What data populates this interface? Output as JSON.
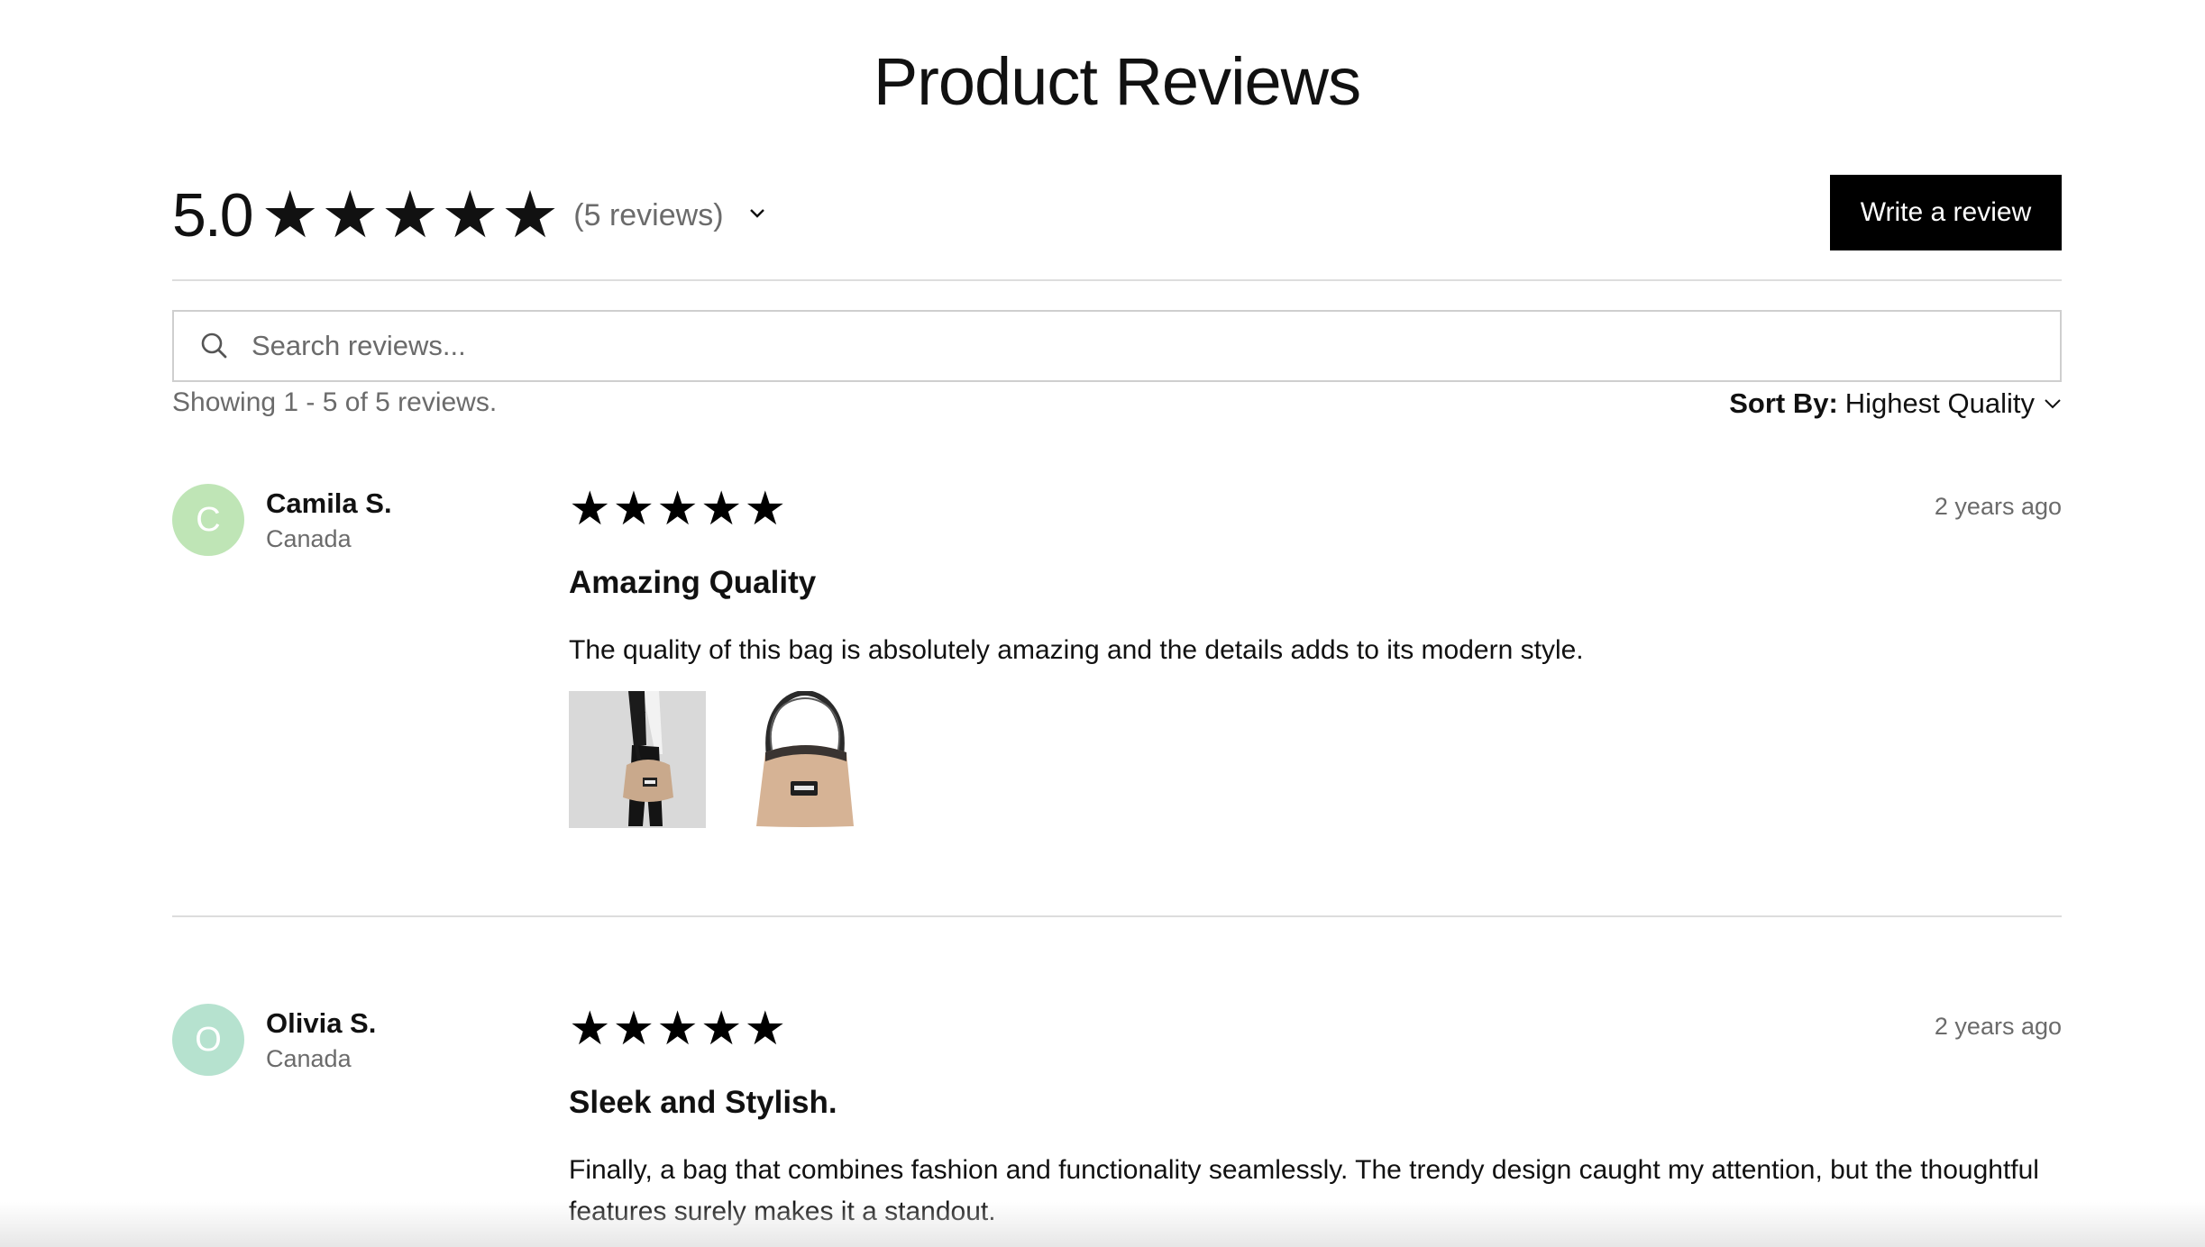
{
  "page_title": "Product Reviews",
  "summary": {
    "average": "5.0",
    "stars": "★★★★★",
    "rating_value": 5,
    "rating_max": 5,
    "count_label": "(5 reviews)"
  },
  "write_review_label": "Write a review",
  "search": {
    "placeholder": "Search reviews...",
    "value": ""
  },
  "showing_text": "Showing 1 - 5 of 5 reviews.",
  "sort": {
    "label": "Sort By:",
    "value": "Highest Quality"
  },
  "colors": {
    "button_bg": "#000000",
    "avatar_camila": "#bfe5b6",
    "avatar_olivia": "#b6e2cf",
    "muted_text": "#6b6b6b"
  },
  "reviews": [
    {
      "initial": "C",
      "name": "Camila S.",
      "location": "Canada",
      "stars": "★★★★★",
      "rating": 5,
      "date": "2 years ago",
      "title": "Amazing Quality",
      "body": "The quality of this bag is absolutely amazing and the details adds to its modern style.",
      "photos": [
        "person-holding-bag-photo",
        "tan-hobo-bag-photo"
      ]
    },
    {
      "initial": "O",
      "name": "Olivia S.",
      "location": "Canada",
      "stars": "★★★★★",
      "rating": 5,
      "date": "2 years ago",
      "title": "Sleek and Stylish.",
      "body": "Finally, a bag that combines fashion and functionality seamlessly. The trendy design caught my attention, but the thoughtful features surely makes it a standout."
    }
  ]
}
